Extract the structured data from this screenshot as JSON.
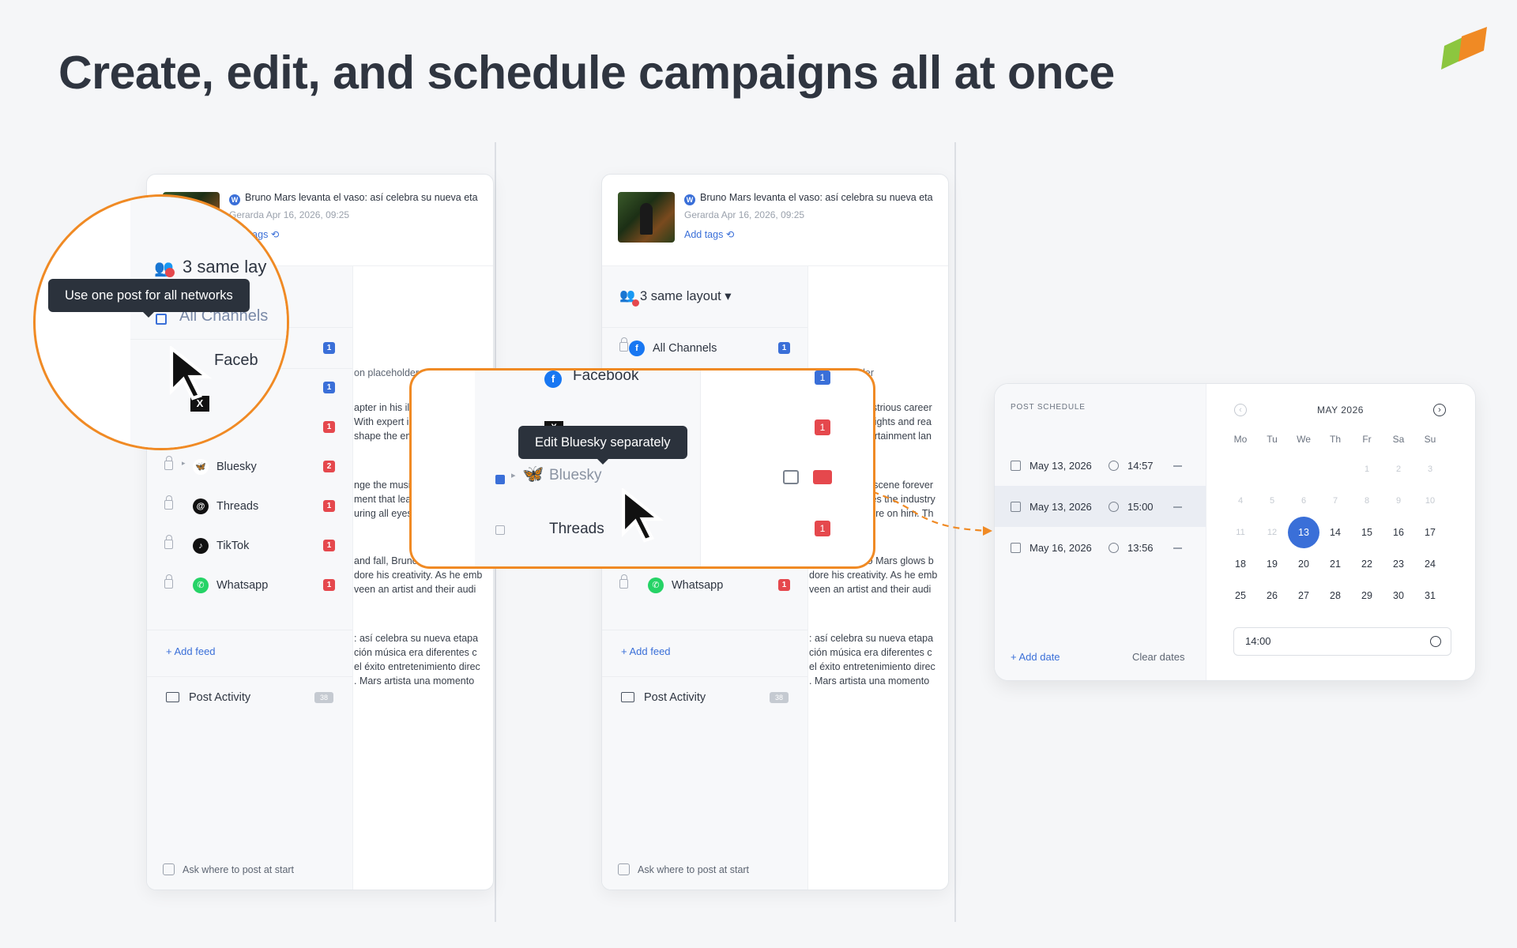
{
  "headline": "Create, edit, and schedule campaigns all at once",
  "colors": {
    "accent_orange": "#f08a24",
    "brand_blue": "#3a6fd8",
    "badge_red": "#e5484d"
  },
  "article": {
    "title": "Bruno Mars levanta el vaso: así celebra su nueva eta",
    "meta": "Gerarda  Apr 16, 2026, 09:25",
    "add_tags": "Add tags",
    "wp_icon": "wordpress-icon"
  },
  "sidebar": {
    "layout_label": "3 same layout ▾",
    "channels": [
      {
        "name": "All Channels",
        "icon": "facebook-icon",
        "count": "1",
        "count_color": "#3a6fd8",
        "glyph": "f",
        "bg": "#1877f2"
      },
      {
        "name": "Facebook",
        "icon": "facebook-icon",
        "count": "1",
        "count_color": "#3a6fd8",
        "glyph": "f",
        "bg": "#1877f2"
      },
      {
        "name": "X",
        "icon": "x-icon",
        "count": "1",
        "count_color": "#e5484d",
        "glyph": "X",
        "bg": "#111"
      },
      {
        "name": "Bluesky",
        "icon": "bluesky-icon",
        "count": "2",
        "count_color": "#e5484d",
        "glyph": "🦋",
        "bg": "#fff"
      },
      {
        "name": "Threads",
        "icon": "threads-icon",
        "count": "1",
        "count_color": "#e5484d",
        "glyph": "@",
        "bg": "#111"
      },
      {
        "name": "TikTok",
        "icon": "tiktok-icon",
        "count": "1",
        "count_color": "#e5484d",
        "glyph": "♪",
        "bg": "#111"
      },
      {
        "name": "Whatsapp",
        "icon": "whatsapp-icon",
        "count": "1",
        "count_color": "#e5484d",
        "glyph": "✆",
        "bg": "#25d366"
      }
    ],
    "add_feed": "+ Add feed",
    "post_activity": "Post Activity",
    "post_activity_count": "38",
    "ask_label": "Ask where to post at start"
  },
  "content": {
    "placeholder": "on placeholder",
    "p1": [
      "apter in his illustrious career",
      "With expert insights and rea",
      "shape the entertainment lan"
    ],
    "p2": [
      "nge the music scene forever",
      "ment that leaves the industry",
      "uring all eyes are on him. Th"
    ],
    "p3": [
      "and fall, Bruno Mars glows b",
      "dore his creativity. As he emb",
      "veen an artist and their audi"
    ],
    "p4": [
      ": así celebra su nueva etapa",
      "ción música era diferentes c",
      "el éxito entretenimiento direc",
      ". Mars artista una momento"
    ]
  },
  "tooltip1": "Use one post for all networks",
  "zoom1": {
    "layout": "3 same lay",
    "channel": "All Channels",
    "facebook": "Faceb"
  },
  "tooltip2": "Edit Bluesky separately",
  "zoom2": {
    "facebook": "Facebook",
    "x": "X",
    "bluesky": "Bluesky",
    "threads": "Threads"
  },
  "schedule": {
    "title": "POST SCHEDULE",
    "rows": [
      {
        "date": "May 13, 2026",
        "time": "14:57"
      },
      {
        "date": "May 13, 2026",
        "time": "15:00"
      },
      {
        "date": "May 16, 2026",
        "time": "13:56"
      }
    ],
    "add_date": "+ Add date",
    "clear_dates": "Clear dates",
    "month": "MAY 2026",
    "weekdays": [
      "Mo",
      "Tu",
      "We",
      "Th",
      "Fr",
      "Sa",
      "Su"
    ],
    "weeks": [
      [
        "",
        "",
        "",
        "",
        "1",
        "2",
        "3"
      ],
      [
        "4",
        "5",
        "6",
        "7",
        "8",
        "9",
        "10"
      ],
      [
        "11",
        "12",
        "13",
        "14",
        "15",
        "16",
        "17"
      ],
      [
        "18",
        "19",
        "20",
        "21",
        "22",
        "23",
        "24"
      ],
      [
        "25",
        "26",
        "27",
        "28",
        "29",
        "30",
        "31"
      ]
    ],
    "selected_day": "13",
    "time_value": "14:00"
  }
}
